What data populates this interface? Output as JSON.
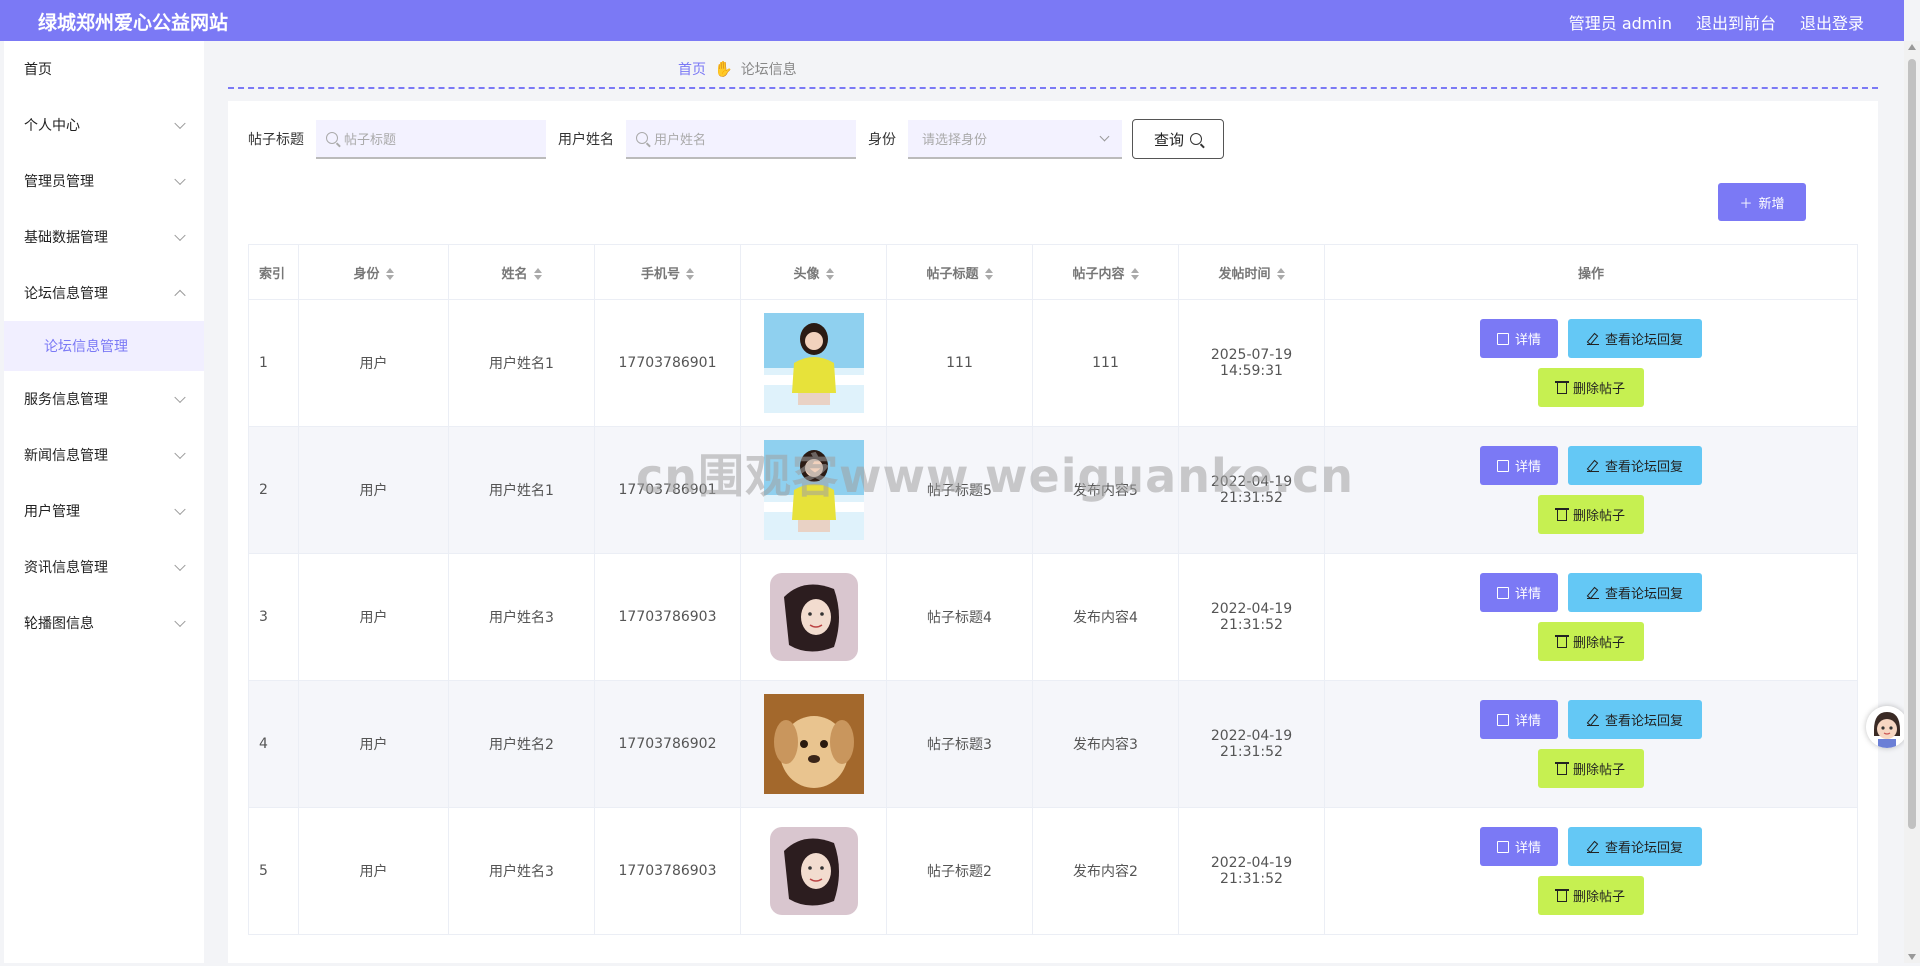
{
  "header": {
    "title": "绿城郑州爱心公益网站",
    "admin_label": "管理员 admin",
    "to_front_label": "退出到前台",
    "logout_label": "退出登录"
  },
  "sidebar": {
    "items": [
      {
        "label": "首页"
      },
      {
        "label": "个人中心"
      },
      {
        "label": "管理员管理"
      },
      {
        "label": "基础数据管理"
      },
      {
        "label": "论坛信息管理"
      },
      {
        "label": "论坛信息管理"
      },
      {
        "label": "服务信息管理"
      },
      {
        "label": "新闻信息管理"
      },
      {
        "label": "用户管理"
      },
      {
        "label": "资讯信息管理"
      },
      {
        "label": "轮播图信息"
      }
    ]
  },
  "breadcrumb": {
    "home": "首页",
    "current": "论坛信息"
  },
  "search": {
    "title_label": "帖子标题",
    "title_placeholder": "帖子标题",
    "name_label": "用户姓名",
    "name_placeholder": "用户姓名",
    "role_label": "身份",
    "role_placeholder": "请选择身份",
    "query_label": "查询"
  },
  "toolbar": {
    "add_label": "新增"
  },
  "table": {
    "headers": [
      "索引",
      "身份",
      "姓名",
      "手机号",
      "头像",
      "帖子标题",
      "帖子内容",
      "发帖时间",
      "操作"
    ],
    "rows": [
      {
        "idx": "1",
        "role": "用户",
        "name": "用户姓名1",
        "phone": "17703786901",
        "avatar": "girl-yellow",
        "title": "111",
        "content": "111",
        "time": "2025-07-19 14:59:31"
      },
      {
        "idx": "2",
        "role": "用户",
        "name": "用户姓名1",
        "phone": "17703786901",
        "avatar": "girl-yellow",
        "title": "帖子标题5",
        "content": "发布内容5",
        "time": "2022-04-19 21:31:52"
      },
      {
        "idx": "3",
        "role": "用户",
        "name": "用户姓名3",
        "phone": "17703786903",
        "avatar": "pillow-portrait",
        "title": "帖子标题4",
        "content": "发布内容4",
        "time": "2022-04-19 21:31:52"
      },
      {
        "idx": "4",
        "role": "用户",
        "name": "用户姓名2",
        "phone": "17703786902",
        "avatar": "puppy",
        "title": "帖子标题3",
        "content": "发布内容3",
        "time": "2022-04-19 21:31:52"
      },
      {
        "idx": "5",
        "role": "用户",
        "name": "用户姓名3",
        "phone": "17703786903",
        "avatar": "pillow-portrait",
        "title": "帖子标题2",
        "content": "发布内容2",
        "time": "2022-04-19 21:31:52"
      }
    ],
    "op_detail": "详情",
    "op_reply": "查看论坛回复",
    "op_delete": "删除帖子"
  },
  "watermark": "cn围观客www.weiguanke.cn",
  "colors": {
    "primary": "#7b79f5",
    "reply": "#64c8f5",
    "delete": "#c6f051"
  }
}
